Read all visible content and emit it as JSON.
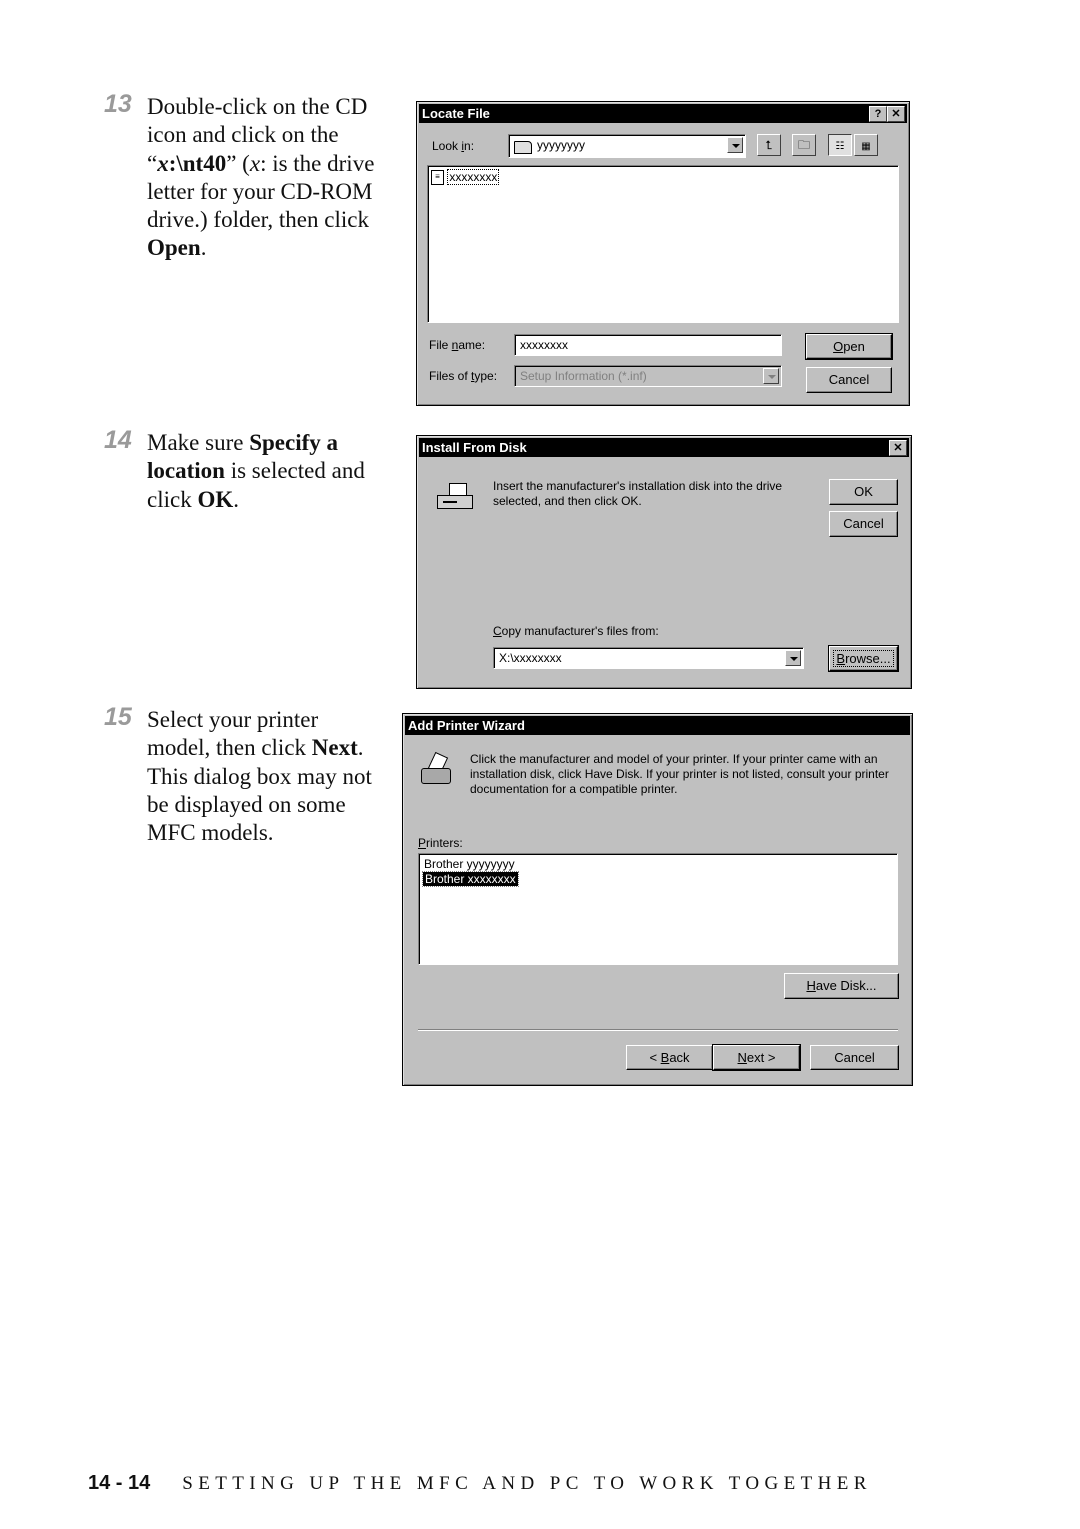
{
  "steps": [
    {
      "number": "13",
      "text_parts": [
        "Double-click on the CD icon and click on the “",
        "x",
        ":\\nt40",
        "” (",
        "x",
        ": is the drive letter for your CD-ROM drive.) folder, then click ",
        "Open",
        "."
      ]
    },
    {
      "number": "14",
      "text_parts": [
        "Make sure ",
        "Specify a location",
        " is selected and click ",
        "OK",
        "."
      ]
    },
    {
      "number": "15",
      "text_parts": [
        "Select your printer model, then click ",
        "Next",
        ". This dialog box may not be displayed on some MFC models."
      ]
    }
  ],
  "locate_file": {
    "title": "Locate File",
    "help_button": "?",
    "close_button": "✕",
    "look_in_label_pre": "Look ",
    "look_in_label_u": "i",
    "look_in_label_post": "n:",
    "look_in_value": "yyyyyyyy",
    "files": [
      "xxxxxxxx"
    ],
    "file_name_label_pre": "File ",
    "file_name_label_u": "n",
    "file_name_label_post": "ame:",
    "file_name_value": "xxxxxxxx",
    "file_type_label_pre": "Files of ",
    "file_type_label_u": "t",
    "file_type_label_post": "ype:",
    "file_type_value": "Setup Information (*.inf)",
    "open_u": "O",
    "open_rest": "pen",
    "cancel": "Cancel",
    "toolbar_icons": [
      "up-one-level-icon",
      "create-new-folder-icon",
      "list-view-icon",
      "details-view-icon"
    ]
  },
  "install_from_disk": {
    "title": "Install From Disk",
    "close_button": "✕",
    "message": "Insert the manufacturer's installation disk into the drive selected, and then click OK.",
    "ok": "OK",
    "cancel": "Cancel",
    "copy_label_u": "C",
    "copy_label_rest": "opy manufacturer's files from:",
    "copy_value": "X:\\xxxxxxxx",
    "browse_u": "B",
    "browse_rest": "rowse..."
  },
  "add_printer_wizard": {
    "title": "Add Printer Wizard",
    "message": "Click the manufacturer and model of your printer.  If your printer came with an installation disk, click Have Disk.  If your printer is not listed, consult your printer documentation for a compatible printer.",
    "printers_label_u": "P",
    "printers_label_rest": "rinters:",
    "printers": [
      "Brother yyyyyyyy",
      "Brother xxxxxxxx"
    ],
    "selected_index": 1,
    "have_disk_u": "H",
    "have_disk_rest": "ave Disk...",
    "back_pre": "< ",
    "back_u": "B",
    "back_rest": "ack",
    "next_u": "N",
    "next_rest": "ext >",
    "cancel": "Cancel"
  },
  "footer": {
    "page": "14 - 14",
    "title": "SETTING UP THE MFC AND PC TO WORK TOGETHER"
  }
}
